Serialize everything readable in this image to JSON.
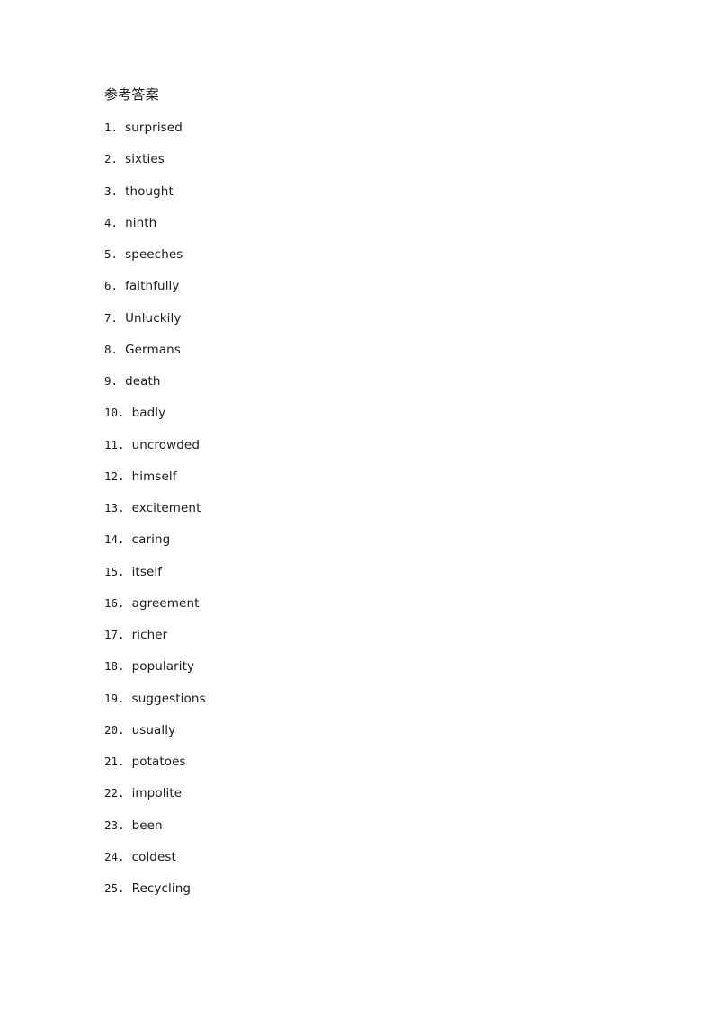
{
  "document": {
    "heading": "参考答案",
    "background_color": "#ffffff",
    "text_color": "#1a1a1a"
  },
  "answers": [
    {
      "number": "1.",
      "word": "surprised"
    },
    {
      "number": "2.",
      "word": "sixties"
    },
    {
      "number": "3.",
      "word": "thought"
    },
    {
      "number": "4.",
      "word": "ninth"
    },
    {
      "number": "5.",
      "word": "speeches"
    },
    {
      "number": "6.",
      "word": "faithfully"
    },
    {
      "number": "7.",
      "word": "Unluckily"
    },
    {
      "number": "8.",
      "word": "Germans"
    },
    {
      "number": "9.",
      "word": "death"
    },
    {
      "number": "10.",
      "word": "badly"
    },
    {
      "number": "11.",
      "word": "uncrowded"
    },
    {
      "number": "12.",
      "word": "himself"
    },
    {
      "number": "13.",
      "word": "excitement"
    },
    {
      "number": "14.",
      "word": "caring"
    },
    {
      "number": "15.",
      "word": "itself"
    },
    {
      "number": "16.",
      "word": "agreement"
    },
    {
      "number": "17.",
      "word": "richer"
    },
    {
      "number": "18.",
      "word": "popularity"
    },
    {
      "number": "19.",
      "word": "suggestions"
    },
    {
      "number": "20.",
      "word": "usually"
    },
    {
      "number": "21.",
      "word": "potatoes"
    },
    {
      "number": "22.",
      "word": "impolite"
    },
    {
      "number": "23.",
      "word": "been"
    },
    {
      "number": "24.",
      "word": "coldest"
    },
    {
      "number": "25.",
      "word": "Recycling"
    }
  ]
}
